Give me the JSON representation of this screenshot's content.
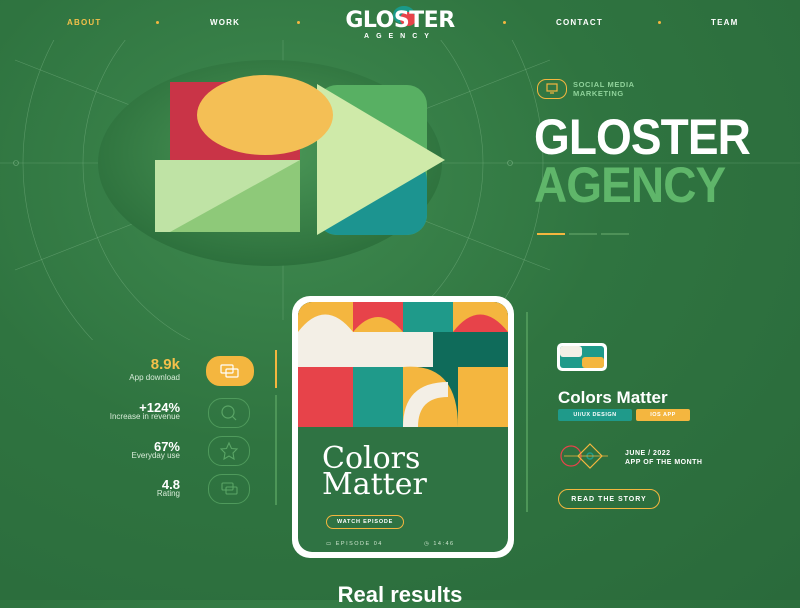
{
  "nav": {
    "items": [
      {
        "label": "ABOUT",
        "active": true
      },
      {
        "label": "WORK",
        "active": false
      },
      {
        "label": "CONTACT",
        "active": false
      },
      {
        "label": "TEAM",
        "active": false
      }
    ],
    "logo_main": "GLOSTER",
    "logo_sub": "AGENCY"
  },
  "hero": {
    "tag": "SOCIAL MEDIA\nMARKETING",
    "title_line1": "GLOSTER",
    "title_line2": "AGENCY"
  },
  "stats": [
    {
      "value": "8.9k",
      "label": "App download",
      "icon": "chat-icon",
      "active": true
    },
    {
      "value": "+124%",
      "label": "Increase in revenue",
      "icon": "search-icon",
      "active": false
    },
    {
      "value": "67%",
      "label": "Everyday use",
      "icon": "star-icon",
      "active": false
    },
    {
      "value": "4.8",
      "label": "Rating",
      "icon": "chat-icon",
      "active": false
    }
  ],
  "phone": {
    "title_line1": "Colors",
    "title_line2": "Matter",
    "watch_label": "WATCH EPISODE",
    "episode": "EPISODE 04",
    "duration": "14:46"
  },
  "card": {
    "title": "Colors Matter",
    "chips": [
      "UI/UX DESIGN",
      "IOS APP"
    ],
    "award_line1": "JUNE / 2022",
    "award_line2": "APP OF THE MONTH",
    "story_label": "READ THE STORY"
  },
  "bottom_title": "Real results",
  "colors": {
    "background": "#2f7440",
    "accent_yellow": "#f4b63f",
    "accent_teal": "#1a9a8a",
    "accent_red": "#e7434a",
    "accent_green": "#5fb66a"
  }
}
